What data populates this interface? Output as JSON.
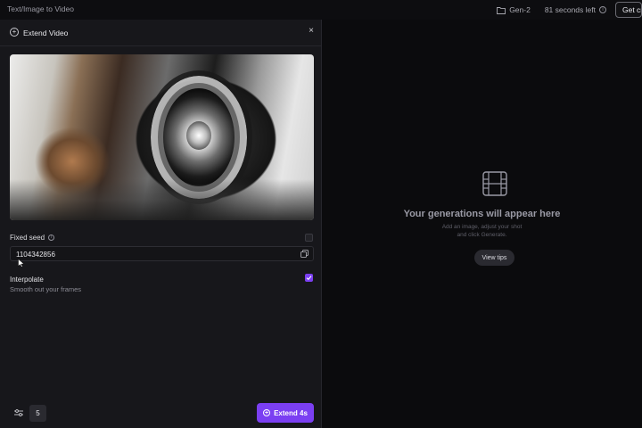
{
  "topbar": {
    "breadcrumb": "Text/Image to Video",
    "folder_label": "Gen-2",
    "credits_label": "81 seconds left",
    "get_button_label": "Get credits"
  },
  "panel": {
    "title": "Extend Video",
    "close_label": "×",
    "fixed_seed": {
      "label": "Fixed seed",
      "value": "1104342856",
      "enabled": false
    },
    "interpolate": {
      "label": "Interpolate",
      "subtitle": "Smooth out your frames",
      "checked": true
    },
    "footer": {
      "count": "5",
      "extend_label": "Extend 4s"
    }
  },
  "empty_state": {
    "headline": "Your generations will appear here",
    "line1": "Add an image, adjust your shot",
    "line2": "and click Generate.",
    "tips_label": "View tips"
  },
  "colors": {
    "accent": "#7b3ff2",
    "panel_bg": "#17171b",
    "page_bg": "#0b0b0d"
  },
  "icons": [
    "folder-icon",
    "info-icon",
    "extend-icon",
    "close-icon",
    "copy-icon",
    "check-icon",
    "sliders-icon",
    "plus-circle-icon",
    "film-icon",
    "cursor-icon"
  ]
}
